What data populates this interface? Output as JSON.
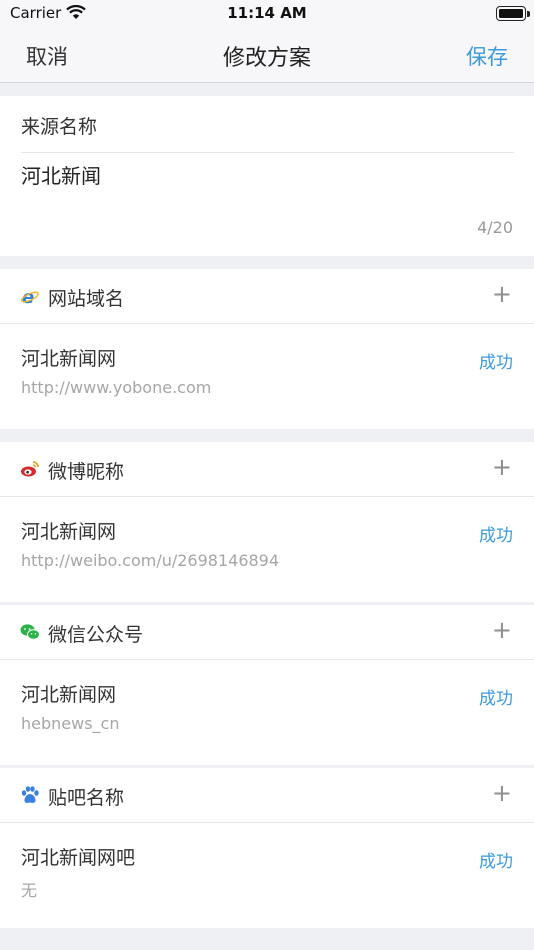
{
  "status_bar": {
    "carrier": "Carrier",
    "time": "11:14 AM"
  },
  "nav": {
    "cancel": "取消",
    "title": "修改方案",
    "save": "保存"
  },
  "name_card": {
    "label": "来源名称",
    "value": "河北新闻",
    "count": "4/20"
  },
  "sections": [
    {
      "icon": "ie-browser-icon",
      "title": "网站域名",
      "add": "+",
      "item": {
        "name": "河北新闻网",
        "sub": "http://www.yobone.com",
        "status": "成功"
      }
    },
    {
      "icon": "weibo-icon",
      "title": "微博昵称",
      "add": "+",
      "item": {
        "name": "河北新闻网",
        "sub": "http://weibo.com/u/2698146894",
        "status": "成功"
      }
    },
    {
      "icon": "wechat-icon",
      "title": "微信公众号",
      "add": "+",
      "item": {
        "name": "河北新闻网",
        "sub": "hebnews_cn",
        "status": "成功"
      }
    },
    {
      "icon": "baidu-paw-icon",
      "title": "贴吧名称",
      "add": "+",
      "item": {
        "name": "河北新闻网吧",
        "sub": "无",
        "status": "成功"
      }
    }
  ],
  "colors": {
    "accent": "#3b9bdc",
    "background": "#eef0f4",
    "weibo": "#d52b2b",
    "wechat": "#2bb34a",
    "ie": "#2a80d8",
    "baidu": "#3b7fe0"
  }
}
